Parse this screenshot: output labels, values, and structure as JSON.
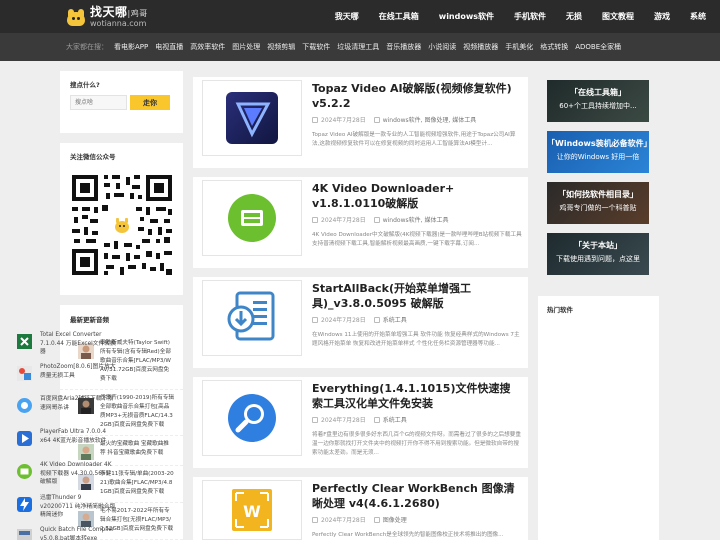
{
  "site": {
    "logo_cn": "找天哪",
    "logo_cn_small": "|鸡哥",
    "logo_en": "wotianna.com"
  },
  "nav": {
    "items": [
      "我天哪",
      "在线工具箱",
      "windows软件",
      "手机软件",
      "无损",
      "图文教程",
      "游戏",
      "系统"
    ]
  },
  "subnav": {
    "hint": "大家都在搜：",
    "items": [
      "看电影APP",
      "电视直播",
      "高效率软件",
      "图片处理",
      "视频剪辑",
      "下载软件",
      "垃圾清理工具",
      "音乐播放器",
      "小说阅读",
      "视频播放器",
      "手机美化",
      "格式转换",
      "ADOBE全家桶"
    ]
  },
  "left": {
    "search_title": "搜点什么?",
    "search_placeholder": "搜点啥",
    "search_button": "走你",
    "wechat_title": "关注微信公众号",
    "music_title": "最新更新音频",
    "music": [
      "泰勒斯威夫特(Taylor Swift)所有专辑(含有专辑Red)全部歌曲音乐合集[FLAC/MP3/WAV/31.72GB]百度云网盘免费下载",
      "任贤齐(1990-2019)所有专辑全部歌曲音乐合集打包[高品质MP3+无损音质FLAC/14.32GB]百度云网盘免费下载",
      "最火的宝藏歌曲 宝藏歌曲推荐 抖音宝藏歌曲免费下载",
      "李健11张专辑/单曲(2003-2021)歌曲合集[FLAC/MP3/4.81GB]百度云网盘免费下载",
      "毛不易2017-2022年所有专辑合集打包[无损FLAC/MP3/2.52GB]百度云网盘免费下载"
    ]
  },
  "articles": [
    {
      "title": "Topaz Video AI破解版(视频修复软件) v5.2.2",
      "date": "2024年7月28日",
      "cats": "windows软件, 图像处理, 媒体工具",
      "desc": "Topaz Video AI破解版是一款专业的人工智能视频增强软件,用途于Topaz公司AI算法,这款视频修复软件可以在修复视频的同时运用人工智能算法AI模型计..."
    },
    {
      "title": "4K Video Downloader+ v1.8.1.0110破解版",
      "date": "2024年7月28日",
      "cats": "windows软件, 媒体工具",
      "desc": "4K Video Downloader中文破解版(4K视频下载器)是一款哔哩哔哩B站视频下载工具支持普清视频下载工具,智能解析视频最高画质,一键下载字幕,订阅..."
    },
    {
      "title": "StartAllBack(开始菜单增强工具)_v3.8.0.5095 破解版",
      "date": "2024年7月28日",
      "cats": "系统工具",
      "desc": "在Windows 11上使用的开始菜单增强工具 软件功能 恢复经典样式的Windows 7主题风格开始菜单 恢复和改进开始菜单样式 个性化任务栏资源管理器等功能..."
    },
    {
      "title": "Everything(1.4.1.1015)文件快速搜索工具汉化单文件免安装",
      "date": "2024年7月28日",
      "cats": "系统工具",
      "desc": "将着F盘里边有很多很多好东西几百个G的视频文件呀。而需看过了很多的之后想要重温一边你那就找打开文件夹中的视频打开你不得不用到搜索功能。但是微软自带的搜索功能太差劲。而是无须..."
    },
    {
      "title": "Perfectly Clear WorkBench 图像清晰处理 v4(4.6.1.2680)",
      "date": "2024年7月28日",
      "cats": "图像处理",
      "desc": "Perfectly Clear WorkBench是全球领先的智能图像校正技术将推出的图像..."
    }
  ],
  "right": {
    "banners": [
      {
        "title": "「在线工具箱」",
        "sub": "60+个工具持续增加中..."
      },
      {
        "title": "「Windows装机必备软件」",
        "sub": "让你的Windows 好用一倍"
      },
      {
        "title": "「如何找软件相目录」",
        "sub": "鸡哥专门做的一个科普贴"
      },
      {
        "title": "「关于本站」",
        "sub": "下载使用遇到问题，点这里"
      }
    ],
    "hot_title": "热门软件",
    "hot": [
      "Total Excel Converter 7.1.0.44 万能Excel文件转换器",
      "PhotoZoom[8.0.6]图片放大质量无损工具",
      "百度网盘Aria2辅链下载不限速网哥杀讲",
      "PlayerFab Ultra 7.0.0.4 x64 4K蓝光影音播放软件",
      "4K Video Downloader 4K视频下载器 v4.30.0.5651 破解版",
      "迅雷Thunder 9 v20200711 纯净精简融合版 精简迷你",
      "Quick Batch File Compiler v5.0.8.bat脚本转exe"
    ]
  },
  "colors": {
    "topnav": "#2b2b2b",
    "subnav": "#3a3a3a",
    "accent_yellow": "#f9c62c",
    "page_bg": "#eeeeee"
  }
}
